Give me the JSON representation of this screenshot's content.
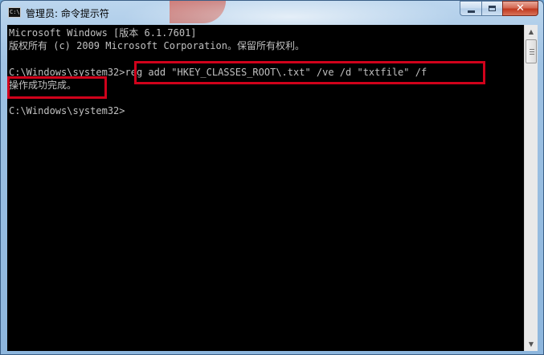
{
  "window": {
    "title": "管理员: 命令提示符",
    "icon_text": "C:\\"
  },
  "controls": {
    "close_label": "✕"
  },
  "console": {
    "lines": [
      "Microsoft Windows [版本 6.1.7601]",
      "版权所有 (c) 2009 Microsoft Corporation。保留所有权利。",
      "",
      "C:\\Windows\\system32>reg add \"HKEY_CLASSES_ROOT\\.txt\" /ve /d \"txtfile\" /f",
      "操作成功完成。",
      "",
      "C:\\Windows\\system32>"
    ]
  },
  "colors": {
    "console_bg": "#000000",
    "console_fg": "#c0c0c0",
    "highlight": "#d0021b"
  }
}
